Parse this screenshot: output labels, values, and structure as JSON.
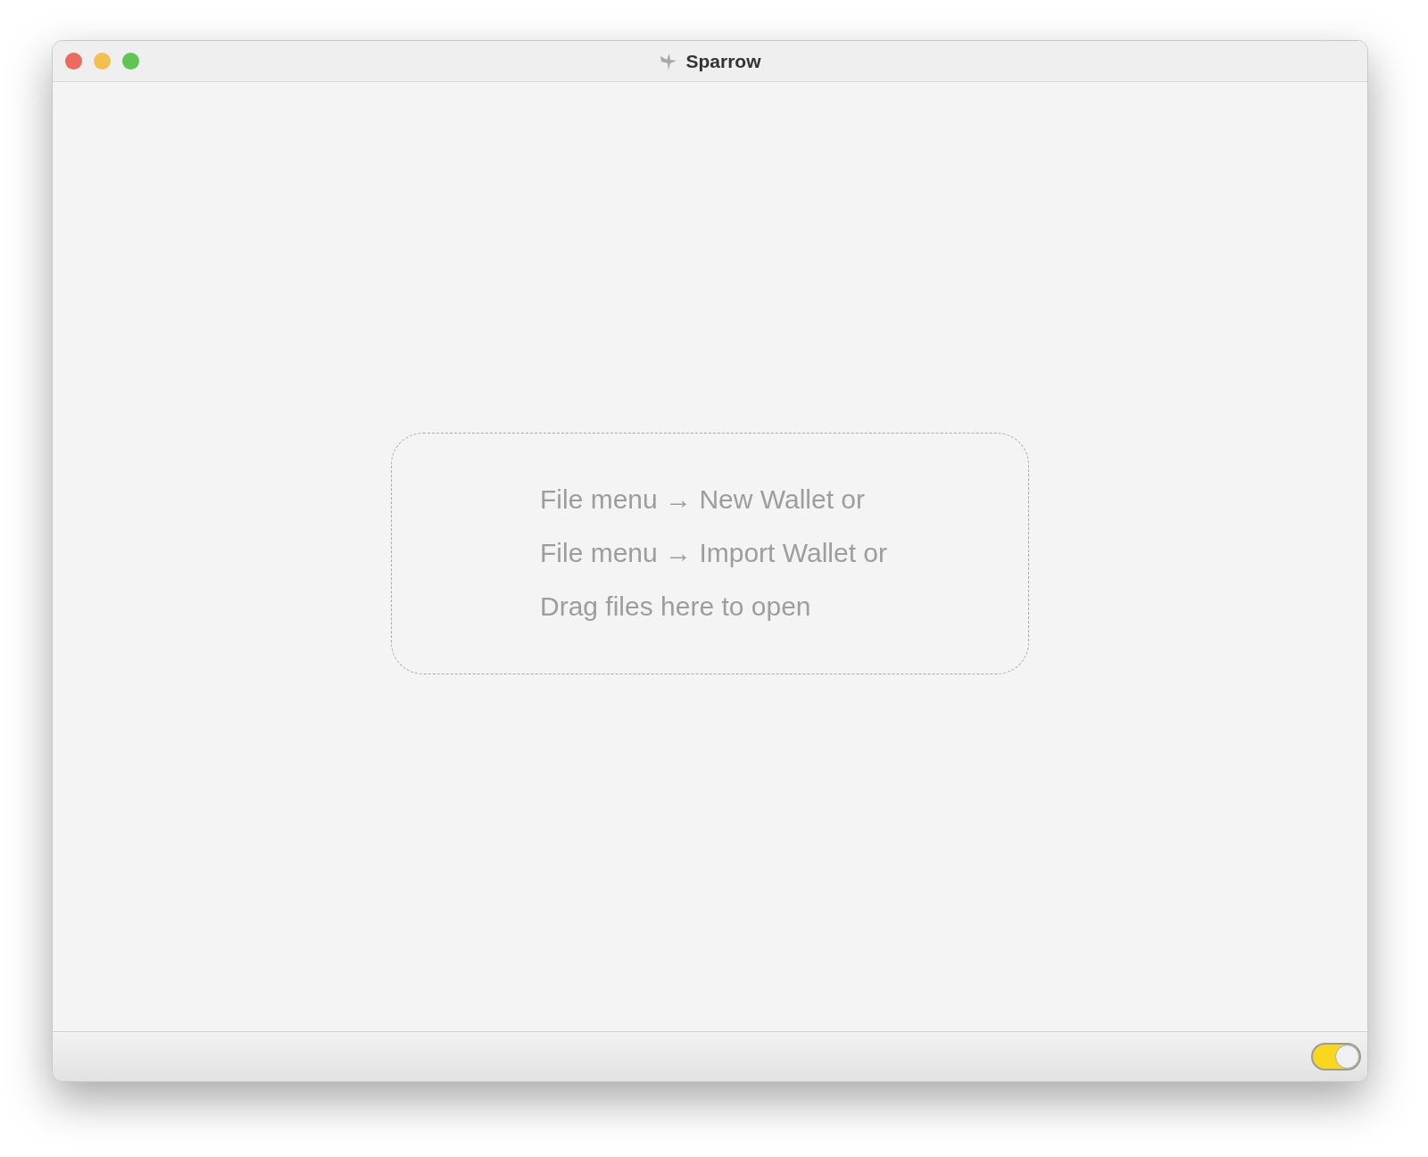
{
  "window": {
    "title": "Sparrow"
  },
  "drop_zone": {
    "lines": [
      "File menu → New Wallet or",
      "File menu → Import Wallet or",
      "Drag files here to open"
    ]
  },
  "status_bar": {
    "toggle": {
      "on": true
    }
  }
}
